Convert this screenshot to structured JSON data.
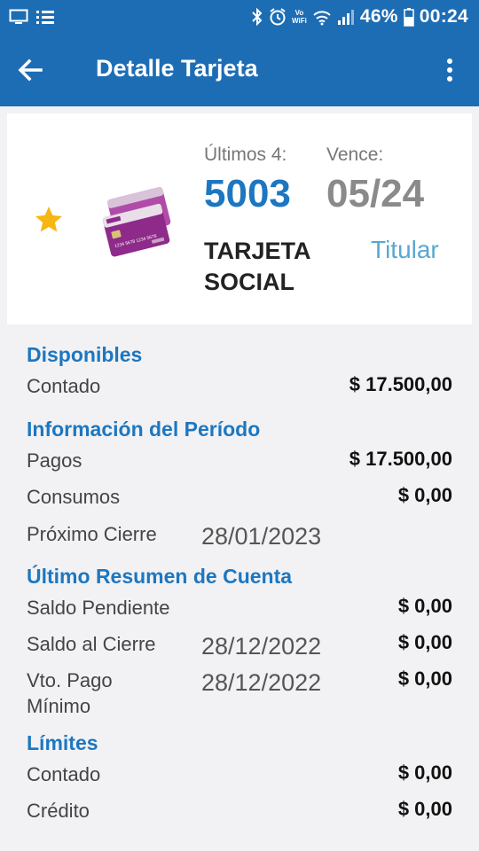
{
  "status_bar": {
    "volte_top": "Vo",
    "volte_bottom": "WiFi",
    "battery": "46%",
    "time": "00:24"
  },
  "app_bar": {
    "title": "Detalle Tarjeta"
  },
  "card": {
    "last4_label": "Últimos 4:",
    "last4": "5003",
    "expiry_label": "Vence:",
    "expiry": "05/24",
    "name": "TARJETA SOCIAL",
    "holder_type": "Titular",
    "card_image_text": "1234 5678 1234 5678"
  },
  "disponibles": {
    "title": "Disponibles",
    "contado_label": "Contado",
    "contado_value": "$ 17.500,00"
  },
  "periodo": {
    "title": "Información del Período",
    "pagos_label": "Pagos",
    "pagos_value": "$ 17.500,00",
    "consumos_label": "Consumos",
    "consumos_value": "$ 0,00",
    "cierre_label": "Próximo Cierre",
    "cierre_date": "28/01/2023"
  },
  "resumen": {
    "title": "Último Resumen de Cuenta",
    "saldo_pendiente_label": "Saldo Pendiente",
    "saldo_pendiente_value": "$ 0,00",
    "saldo_cierre_label": "Saldo al Cierre",
    "saldo_cierre_date": "28/12/2022",
    "saldo_cierre_value": "$ 0,00",
    "vto_pago_label": "Vto. Pago Mínimo",
    "vto_pago_date": "28/12/2022",
    "vto_pago_value": "$ 0,00"
  },
  "limites": {
    "title": "Límites",
    "contado_label": "Contado",
    "contado_value": "$ 0,00",
    "credito_label": "Crédito",
    "credito_value": "$ 0,00"
  },
  "colors": {
    "primary": "#1d6db5",
    "accent": "#1d77c0",
    "holder": "#5aa7d0",
    "star": "#f6b714",
    "card": "#8e2a8a"
  },
  "icons": [
    "screen-icon",
    "list-icon",
    "bluetooth-icon",
    "alarm-icon",
    "wifi-icon",
    "signal-icon",
    "battery-icon",
    "back-arrow-icon",
    "more-vert-icon",
    "star-icon"
  ]
}
